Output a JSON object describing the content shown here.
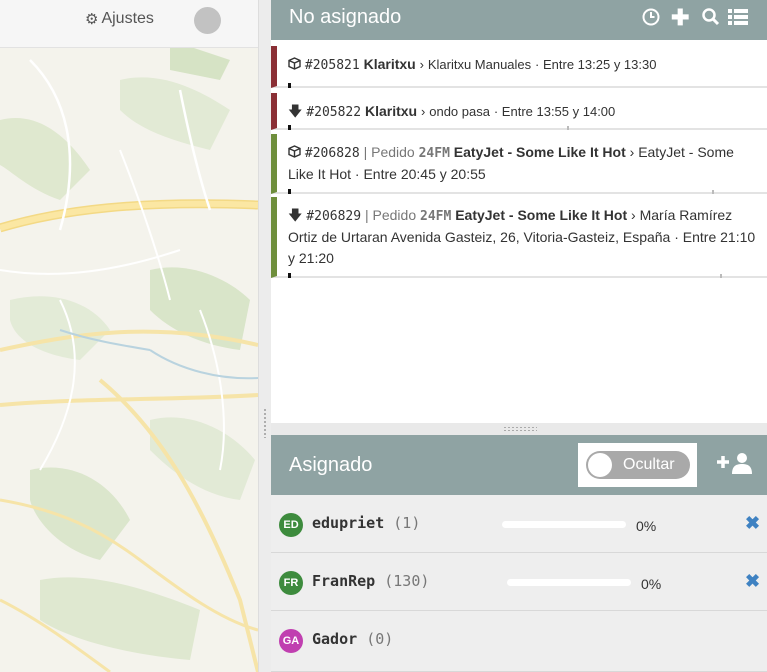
{
  "map_header": {
    "settings_label": "Ajustes",
    "settings_icon": "gear-icon"
  },
  "unassigned": {
    "title": "No asignado",
    "icons": [
      "clock-icon",
      "plus-icon",
      "search-icon",
      "list-icon"
    ],
    "orders": [
      {
        "icon": "box-icon",
        "number": "#205821",
        "customer": "Klaritxu",
        "sep": "›",
        "destination": "Klaritxu Manuales",
        "window": "· Entre 13:25 y 13:30",
        "status_color": "#8a2f35"
      },
      {
        "icon": "arrow-down-icon",
        "number": "#205822",
        "customer": "Klaritxu",
        "sep": "›",
        "destination": "ondo pasa",
        "window": "· Entre 13:55 y 14:00",
        "status_color": "#8a2f35"
      },
      {
        "icon": "box-icon",
        "number": "#206828",
        "pipe": "|",
        "pedido_label": "Pedido",
        "pedido_code": "24FM",
        "customer": "EatyJet - Some Like It Hot",
        "sep": "›",
        "destination": "EatyJet - Some Like It Hot",
        "window": "· Entre 20:45 y 20:55",
        "status_color": "#6e8e3c"
      },
      {
        "icon": "arrow-down-icon",
        "number": "#206829",
        "pipe": "|",
        "pedido_label": "Pedido",
        "pedido_code": "24FM",
        "customer": "EatyJet - Some Like It Hot",
        "sep": "›",
        "destination": "María Ramírez Ortiz de Urtaran Avenida Gasteiz, 26, Vitoria-Gasteiz, España",
        "window": "· Entre 21:10 y 21:20",
        "status_color": "#6e8e3c"
      }
    ]
  },
  "assigned": {
    "title": "Asignado",
    "toggle_label": "Ocultar",
    "add_icon": "add-user-icon",
    "drivers": [
      {
        "initials": "ED",
        "name": "edupriet",
        "count": "(1)",
        "progress": 0,
        "pct": "0%",
        "avatar_color": "#3d8b3d"
      },
      {
        "initials": "FR",
        "name": "FranRep",
        "count": "(130)",
        "progress": 0,
        "pct": "0%",
        "avatar_color": "#3d8b3d"
      },
      {
        "initials": "GA",
        "name": "Gador",
        "count": "(0)",
        "avatar_color": "#c03fb0"
      }
    ]
  },
  "colors": {
    "header_bg": "#8fa3a3",
    "remove_icon": "#3f82c2"
  }
}
